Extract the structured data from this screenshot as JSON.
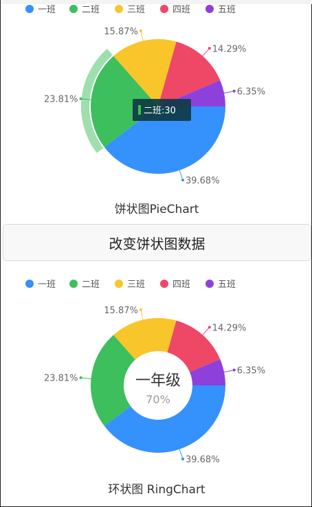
{
  "pie_caption": "饼状图PieChart",
  "change_button_label": "改变饼状图数据",
  "ring_caption": "环状图 RingChart",
  "ring_center": {
    "title": "一年级",
    "value": "70%"
  },
  "tooltip_text": "二班:30",
  "chart_data": [
    {
      "type": "pie",
      "categories": [
        "一班",
        "二班",
        "三班",
        "四班",
        "五班"
      ],
      "values": [
        50,
        30,
        20,
        18,
        8
      ],
      "percent_labels": [
        "39.68%",
        "23.81%",
        "15.87%",
        "14.29%",
        "6.35%"
      ],
      "colors": [
        "#3591fb",
        "#3cbf5c",
        "#f8c52b",
        "#ee4866",
        "#8e40dc"
      ],
      "legend_position": "top-left",
      "highlighted": "二班"
    },
    {
      "type": "pie",
      "categories": [
        "一班",
        "二班",
        "三班",
        "四班",
        "五班"
      ],
      "values": [
        50,
        30,
        20,
        18,
        8
      ],
      "percent_labels": [
        "39.68%",
        "23.81%",
        "15.87%",
        "14.29%",
        "6.35%"
      ],
      "colors": [
        "#3591fb",
        "#3cbf5c",
        "#f8c52b",
        "#ee4866",
        "#8e40dc"
      ],
      "legend_position": "top-left"
    }
  ]
}
